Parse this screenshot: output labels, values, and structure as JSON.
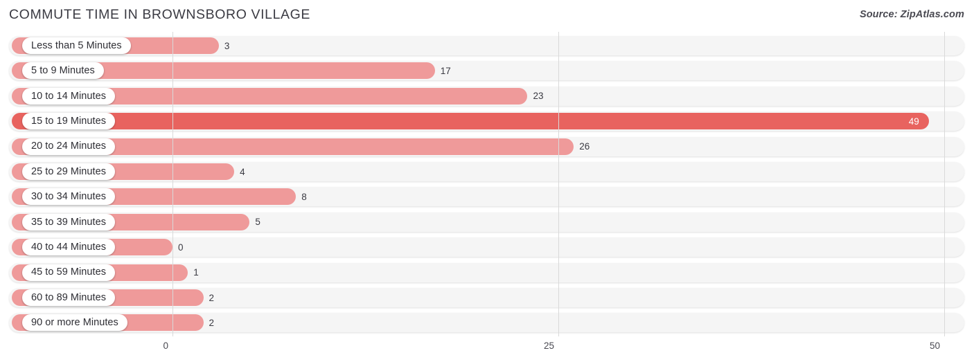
{
  "header": {
    "title": "COMMUTE TIME IN BROWNSBORO VILLAGE",
    "source": "Source: ZipAtlas.com"
  },
  "colors": {
    "bar": "#ef9a9a",
    "bar_highlight": "#e8635f",
    "track": "#f5f5f5",
    "gridline": "#d9d9d9",
    "title_text": "#3b3b43",
    "value_text": "#3a3a42",
    "value_text_inside": "#ffffff"
  },
  "chart_data": {
    "type": "bar",
    "orientation": "horizontal",
    "title": "COMMUTE TIME IN BROWNSBORO VILLAGE",
    "xlabel": "",
    "ylabel": "",
    "xlim": [
      0,
      50
    ],
    "xticks": [
      0,
      25,
      50
    ],
    "xtick_labels": [
      "0",
      "25",
      "50"
    ],
    "grid": true,
    "legend": false,
    "categories": [
      "Less than 5 Minutes",
      "5 to 9 Minutes",
      "10 to 14 Minutes",
      "15 to 19 Minutes",
      "20 to 24 Minutes",
      "25 to 29 Minutes",
      "30 to 34 Minutes",
      "35 to 39 Minutes",
      "40 to 44 Minutes",
      "45 to 59 Minutes",
      "60 to 89 Minutes",
      "90 or more Minutes"
    ],
    "values": [
      3,
      17,
      23,
      49,
      26,
      4,
      8,
      5,
      0,
      1,
      2,
      2
    ],
    "value_labels": [
      "3",
      "17",
      "23",
      "49",
      "26",
      "4",
      "8",
      "5",
      "0",
      "1",
      "2",
      "2"
    ],
    "highlight_index": 3
  }
}
